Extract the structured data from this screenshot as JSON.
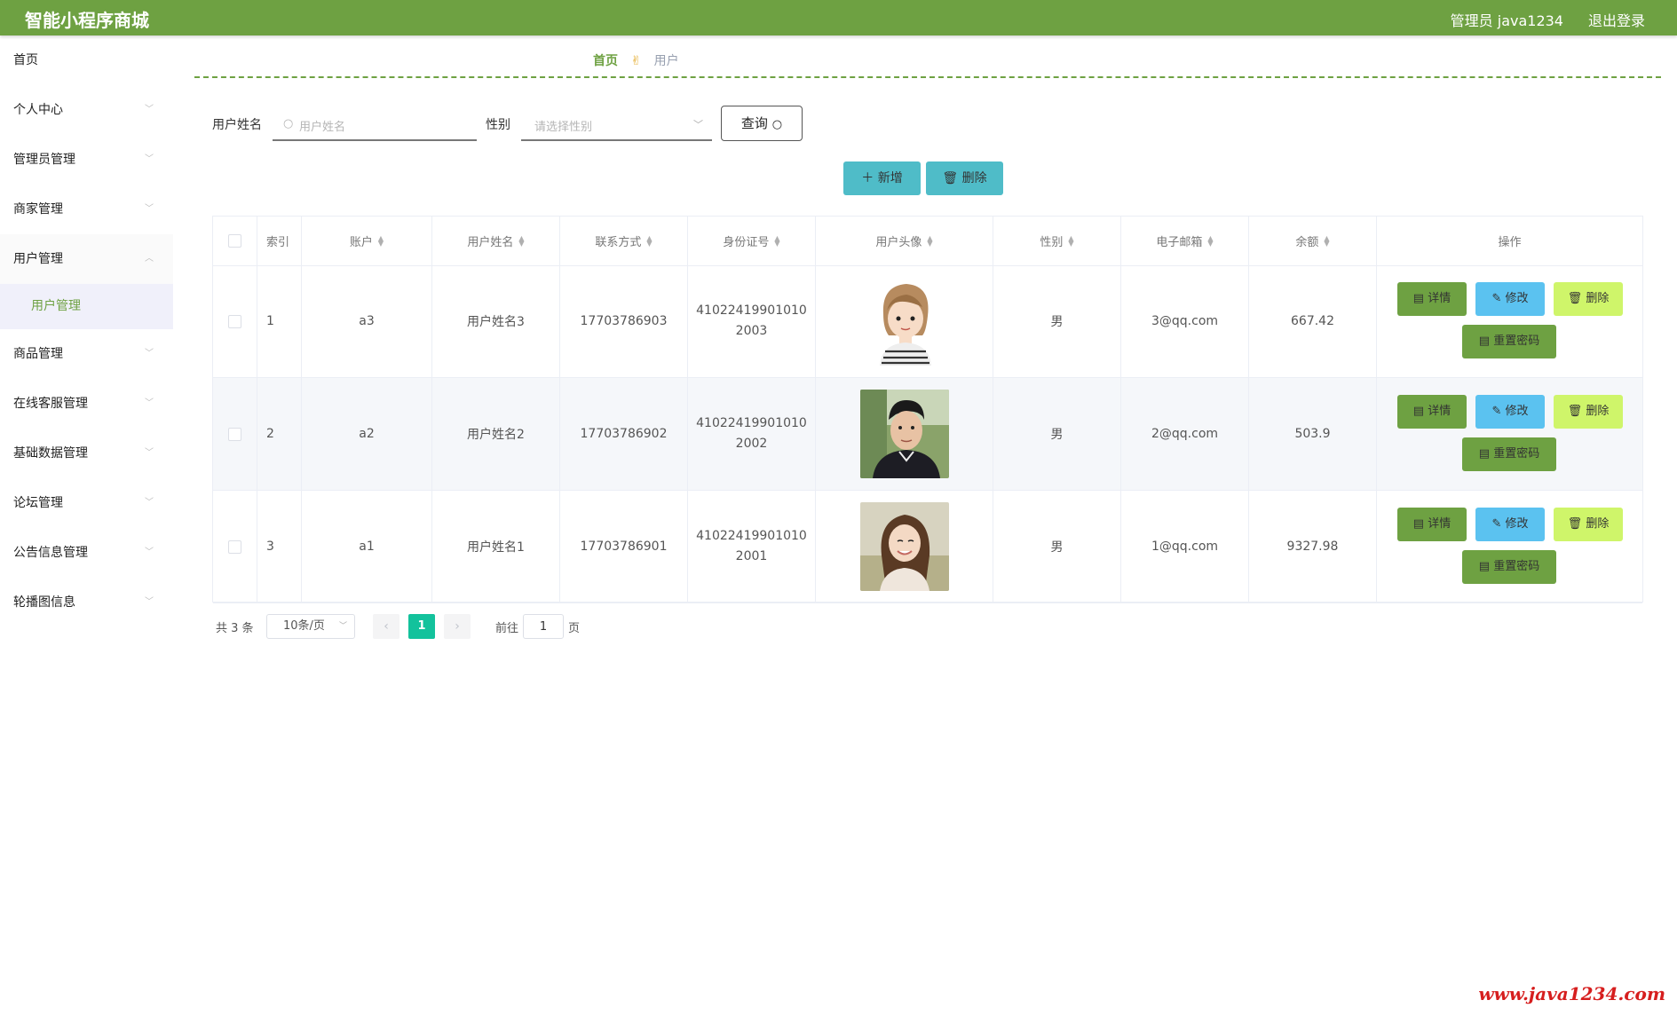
{
  "header": {
    "title": "智能小程序商城",
    "user": "管理员 java1234",
    "logout": "退出登录"
  },
  "sidebar": {
    "items": [
      {
        "label": "首页",
        "chevron": false
      },
      {
        "label": "个人中心",
        "chevron": true
      },
      {
        "label": "管理员管理",
        "chevron": true
      },
      {
        "label": "商家管理",
        "chevron": true
      },
      {
        "label": "用户管理",
        "chevron": true,
        "open": true
      },
      {
        "label": "商品管理",
        "chevron": true
      },
      {
        "label": "在线客服管理",
        "chevron": true
      },
      {
        "label": "基础数据管理",
        "chevron": true
      },
      {
        "label": "论坛管理",
        "chevron": true
      },
      {
        "label": "公告信息管理",
        "chevron": true
      },
      {
        "label": "轮播图信息",
        "chevron": true
      }
    ],
    "sub_item": "用户管理"
  },
  "breadcrumb": {
    "home": "首页",
    "current": "用户"
  },
  "search": {
    "name_label": "用户姓名",
    "name_placeholder": "用户姓名",
    "gender_label": "性别",
    "gender_placeholder": "请选择性别",
    "query_label": "查询"
  },
  "actions": {
    "add": "新增",
    "delete": "删除"
  },
  "table": {
    "headers": {
      "index": "索引",
      "account": "账户",
      "name": "用户姓名",
      "phone": "联系方式",
      "id_card": "身份证号",
      "avatar": "用户头像",
      "gender": "性别",
      "email": "电子邮箱",
      "balance": "余额",
      "ops": "操作"
    },
    "rows": [
      {
        "index": "1",
        "account": "a3",
        "name": "用户姓名3",
        "phone": "17703786903",
        "id_card_1": "41022419901010",
        "id_card_2": "2003",
        "gender": "男",
        "email": "3@qq.com",
        "balance": "667.42",
        "avatar": "cartoon-girl"
      },
      {
        "index": "2",
        "account": "a2",
        "name": "用户姓名2",
        "phone": "17703786902",
        "id_card_1": "41022419901010",
        "id_card_2": "2002",
        "gender": "男",
        "email": "2@qq.com",
        "balance": "503.9",
        "avatar": "young-man"
      },
      {
        "index": "3",
        "account": "a1",
        "name": "用户姓名1",
        "phone": "17703786901",
        "id_card_1": "41022419901010",
        "id_card_2": "2001",
        "gender": "男",
        "email": "1@qq.com",
        "balance": "9327.98",
        "avatar": "smiling-woman"
      }
    ],
    "buttons": {
      "detail": "详情",
      "edit": "修改",
      "del": "删除",
      "reset": "重置密码"
    }
  },
  "pagination": {
    "total": "共 3 条",
    "page_size": "10条/页",
    "current": "1",
    "goto_label": "前往",
    "goto_value": "1",
    "page_suffix": "页"
  },
  "watermark": "www.java1234.com",
  "colors": {
    "brand": "#6ea142",
    "action": "#4fbcc8",
    "edit": "#5bc2f0",
    "danger": "#cff56a",
    "page": "#13c29c"
  }
}
